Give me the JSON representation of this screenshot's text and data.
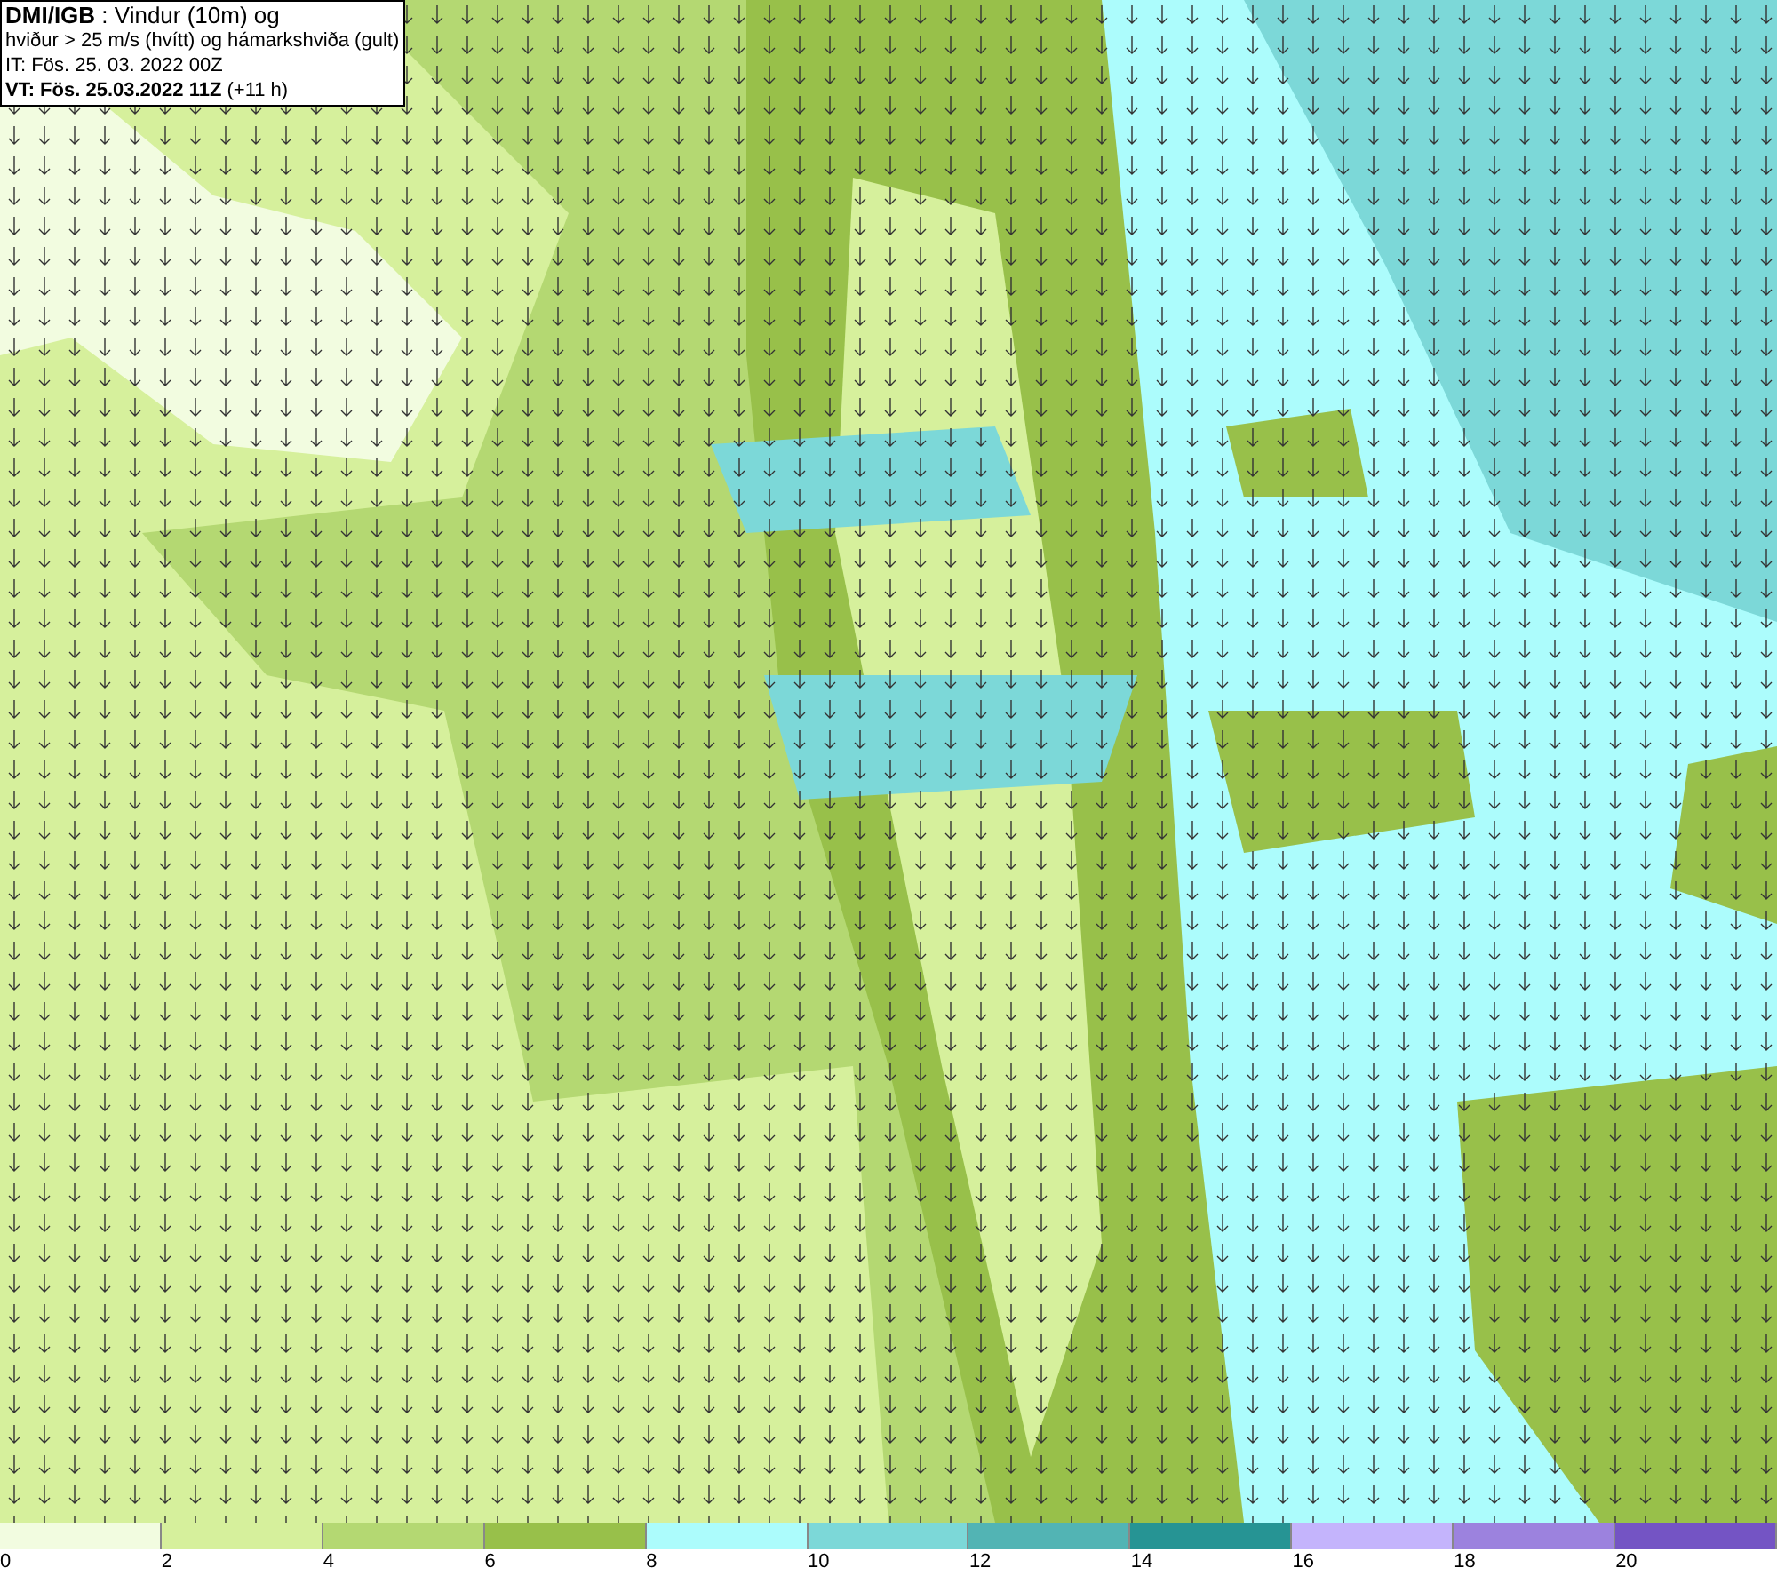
{
  "title_box": {
    "lines": [
      "**DMI/IGB** : Vindur (10m) og",
      "hviður > 25 m/s (hvítt) og hámarkshviða (gult)",
      "IT: Fös. 25. 03. 2022 00Z",
      "**VT: Fös. 25.03.2022 11Z** (+11 h)"
    ]
  },
  "legend": [
    {
      "label": "0",
      "color": "#f2fce0"
    },
    {
      "label": "2",
      "color": "#d6f09c"
    },
    {
      "label": "4",
      "color": "#b4d872"
    },
    {
      "label": "6",
      "color": "#98c04a"
    },
    {
      "label": "8",
      "color": "#acfcfc"
    },
    {
      "label": "10",
      "color": "#7cd8d8"
    },
    {
      "label": "12",
      "color": "#52b4b4"
    },
    {
      "label": "14",
      "color": "#269494"
    },
    {
      "label": "16",
      "color": "#c4b4fc"
    },
    {
      "label": "18",
      "color": "#9c82de"
    },
    {
      "label": "20",
      "color": "#7454c4"
    }
  ]
}
